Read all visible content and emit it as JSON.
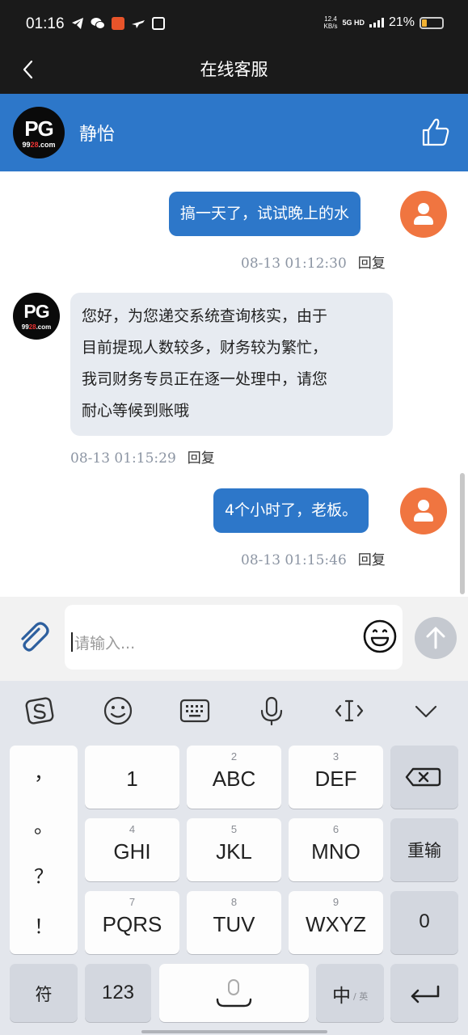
{
  "status_bar": {
    "time": "01:16",
    "net_speed_value": "12.4",
    "net_speed_unit": "KB/s",
    "network": "5G HD",
    "battery": "21%"
  },
  "nav": {
    "title": "在线客服"
  },
  "agent": {
    "name": "静怡",
    "logo_text": "PG",
    "logo_domain_a": "99",
    "logo_domain_b": "28",
    "logo_domain_c": ".com"
  },
  "messages": [
    {
      "from": "me",
      "text": "搞一天了，试试晚上的水",
      "time": "08-13 01:12:30",
      "reply": "回复"
    },
    {
      "from": "agent",
      "lines": [
        "您好，为您递交系统查询核实，由于",
        "目前提现人数较多，财务较为繁忙，",
        "我司财务专员正在逐一处理中，请您",
        "耐心等候到账哦"
      ],
      "time": "08-13 01:15:29",
      "reply": "回复"
    },
    {
      "from": "me",
      "text": "4个小时了，老板。",
      "time": "08-13 01:15:46",
      "reply": "回复"
    }
  ],
  "composer": {
    "placeholder": "请输入..."
  },
  "keyboard": {
    "punctuation": [
      "，",
      "。",
      "？",
      "！"
    ],
    "keys": [
      {
        "num": "",
        "label": "1"
      },
      {
        "num": "2",
        "label": "ABC"
      },
      {
        "num": "3",
        "label": "DEF"
      },
      {
        "num": "4",
        "label": "GHI"
      },
      {
        "num": "5",
        "label": "JKL"
      },
      {
        "num": "6",
        "label": "MNO"
      },
      {
        "num": "7",
        "label": "PQRS"
      },
      {
        "num": "8",
        "label": "TUV"
      },
      {
        "num": "9",
        "label": "WXYZ"
      }
    ],
    "reenter": "重输",
    "zero": "0",
    "symbols": "符",
    "numbers": "123",
    "lang_main": "中",
    "lang_alt": "/ 英"
  },
  "colors": {
    "accent_blue": "#2d77c9",
    "avatar_orange": "#f07540",
    "status_bar_bg": "#1a1a1a",
    "agent_bubble": "#e7ebf1"
  }
}
